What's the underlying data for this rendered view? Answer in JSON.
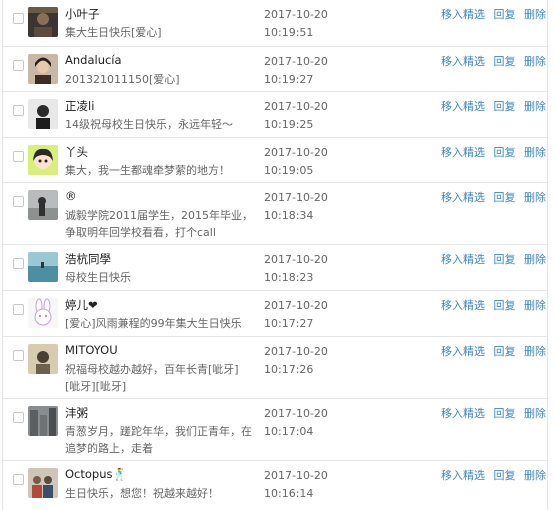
{
  "actions": {
    "feature": "移入精选",
    "reply": "回复",
    "delete": "删除"
  },
  "comments": [
    {
      "name": "小叶子",
      "message": "集大生日快乐[爱心]",
      "time": "2017-10-20 10:19:51",
      "avatar": "avatar-dark-photo"
    },
    {
      "name": "Andalucía",
      "message": "201321011150[爱心]",
      "time": "2017-10-20 10:19:27",
      "avatar": "avatar-girl-portrait"
    },
    {
      "name": "正凌li",
      "message": "14级祝母校生日快乐，永远年轻～",
      "time": "2017-10-20 10:19:25",
      "avatar": "avatar-person-dark"
    },
    {
      "name": "丫头",
      "message": "集大，我一生都魂牵梦萦的地方！",
      "time": "2017-10-20 10:19:05",
      "avatar": "avatar-cartoon-girl"
    },
    {
      "name": "®",
      "message": "诚毅学院2011届学生，2015年毕业，争取明年回学校看看，打个call",
      "time": "2017-10-20 10:18:34",
      "avatar": "avatar-gray-figure"
    },
    {
      "name": "浩杭同學",
      "message": "母校生日快乐",
      "time": "2017-10-20 10:18:23",
      "avatar": "avatar-sea"
    },
    {
      "name": "婷儿❤",
      "message": "[爱心]风雨兼程的99年集大生日快乐",
      "time": "2017-10-20 10:17:27",
      "avatar": "avatar-bunny"
    },
    {
      "name": "MITOYOU",
      "message": "祝福母校越办越好，百年长青[呲牙][呲牙][呲牙]",
      "time": "2017-10-20 10:17:26",
      "avatar": "avatar-man-beige"
    },
    {
      "name": "沣粥",
      "message": "青葱岁月，蹉跎年华，我们正青年，在追梦的路上，走着",
      "time": "2017-10-20 10:17:04",
      "avatar": "avatar-city"
    },
    {
      "name": "Octopus🕺",
      "message": "生日快乐，想您！祝越来越好！",
      "time": "2017-10-20 10:16:14",
      "avatar": "avatar-group"
    }
  ]
}
